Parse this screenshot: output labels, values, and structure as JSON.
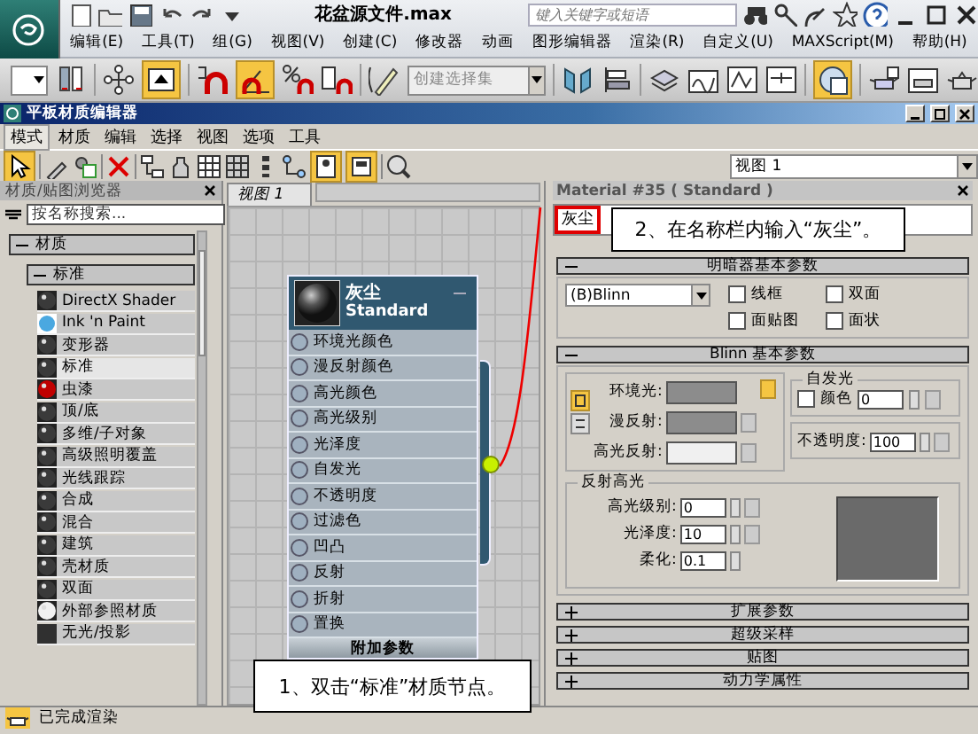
{
  "app": {
    "title": "花盆源文件.max",
    "search": {
      "placeholder": "键入关键字或短语"
    },
    "menu": [
      "编辑(E)",
      "工具(T)",
      "组(G)",
      "视图(V)",
      "创建(C)",
      "修改器",
      "动画",
      "图形编辑器",
      "渲染(R)",
      "自定义(U)",
      "MAXScript(M)",
      "帮助(H)"
    ],
    "selection_set": {
      "placeholder": "创建选择集"
    }
  },
  "editor": {
    "title": "平板材质编辑器",
    "menu": [
      {
        "label": "模式",
        "selected": true
      },
      {
        "label": "材质",
        "selected": false
      },
      {
        "label": "编辑",
        "selected": false
      },
      {
        "label": "选择",
        "selected": false
      },
      {
        "label": "视图",
        "selected": false
      },
      {
        "label": "选项",
        "selected": false
      },
      {
        "label": "工具",
        "selected": false
      }
    ],
    "view_dropdown": "视图 1"
  },
  "browser": {
    "title": "材质/贴图浏览器",
    "search": {
      "placeholder": "按名称搜索..."
    },
    "group": {
      "label": "材质",
      "expanded": true
    },
    "subgroup": {
      "label": "标准",
      "expanded": true
    },
    "items": [
      {
        "label": "DirectX Shader",
        "kind": "sphere",
        "color": "#3a3a3a",
        "selected": false
      },
      {
        "label": "Ink 'n Paint",
        "kind": "flat-circle",
        "color": "#4aa8e0",
        "selected": false
      },
      {
        "label": "变形器",
        "kind": "sphere",
        "color": "#3a3a3a",
        "selected": false
      },
      {
        "label": "标准",
        "kind": "sphere",
        "color": "#3a3a3a",
        "selected": true
      },
      {
        "label": "虫漆",
        "kind": "sphere",
        "color": "#c00000",
        "selected": false
      },
      {
        "label": "顶/底",
        "kind": "sphere",
        "color": "#3a3a3a",
        "selected": false
      },
      {
        "label": "多维/子对象",
        "kind": "sphere",
        "color": "#3a3a3a",
        "selected": false
      },
      {
        "label": "高级照明覆盖",
        "kind": "sphere",
        "color": "#3a3a3a",
        "selected": false
      },
      {
        "label": "光线跟踪",
        "kind": "sphere",
        "color": "#3a3a3a",
        "selected": false
      },
      {
        "label": "合成",
        "kind": "sphere",
        "color": "#3a3a3a",
        "selected": false
      },
      {
        "label": "混合",
        "kind": "sphere",
        "color": "#3a3a3a",
        "selected": false
      },
      {
        "label": "建筑",
        "kind": "sphere",
        "color": "#3a3a3a",
        "selected": false
      },
      {
        "label": "壳材质",
        "kind": "sphere",
        "color": "#3a3a3a",
        "selected": false
      },
      {
        "label": "双面",
        "kind": "sphere",
        "color": "#3a3a3a",
        "selected": false
      },
      {
        "label": "外部参照材质",
        "kind": "sphere",
        "color": "#f0f0f0",
        "selected": false
      },
      {
        "label": "无光/投影",
        "kind": "square",
        "color": "#303030",
        "selected": false
      }
    ]
  },
  "view": {
    "tab": "视图 1",
    "node": {
      "name": "灰尘",
      "type": "Standard",
      "expanded": true,
      "slots": [
        "环境光颜色",
        "漫反射颜色",
        "高光颜色",
        "高光级别",
        "光泽度",
        "自发光",
        "不透明度",
        "过滤色",
        "凹凸",
        "反射",
        "折射",
        "置换"
      ],
      "footer": "附加参数"
    }
  },
  "material": {
    "title": "Material #35 ( Standard )",
    "name": "灰尘",
    "shader_rollout": {
      "title": "明暗器基本参数",
      "expanded": true,
      "shader": "(B)Blinn",
      "options": [
        {
          "label": "线框",
          "checked": false
        },
        {
          "label": "双面",
          "checked": false
        },
        {
          "label": "面贴图",
          "checked": false
        },
        {
          "label": "面状",
          "checked": false
        }
      ]
    },
    "blinn_rollout": {
      "title": "Blinn 基本参数",
      "expanded": true,
      "colors": [
        {
          "label": "环境光:",
          "color": "#8c8c8c"
        },
        {
          "label": "漫反射:",
          "color": "#8c8c8c"
        },
        {
          "label": "高光反射:",
          "color": "#f0f0f0"
        }
      ],
      "self_illum": {
        "title": "自发光",
        "label": "颜色",
        "checked": false,
        "value": "0"
      },
      "opacity": {
        "label": "不透明度:",
        "value": "100"
      },
      "highlights": {
        "title": "反射高光",
        "fields": [
          {
            "label": "高光级别:",
            "value": "0"
          },
          {
            "label": "光泽度:",
            "value": "10"
          },
          {
            "label": "柔化:",
            "value": "0.1"
          }
        ]
      }
    },
    "collapsed_rollouts": [
      {
        "title": "扩展参数",
        "expanded": false
      },
      {
        "title": "超级采样",
        "expanded": false
      },
      {
        "title": "贴图",
        "expanded": false
      },
      {
        "title": "动力学属性",
        "expanded": false
      }
    ]
  },
  "callouts": [
    {
      "text": "1、双击“标准”材质节点。"
    },
    {
      "text": "2、在名称栏内输入“灰尘”。"
    }
  ],
  "status_bar": {
    "text": "已完成渲染"
  }
}
